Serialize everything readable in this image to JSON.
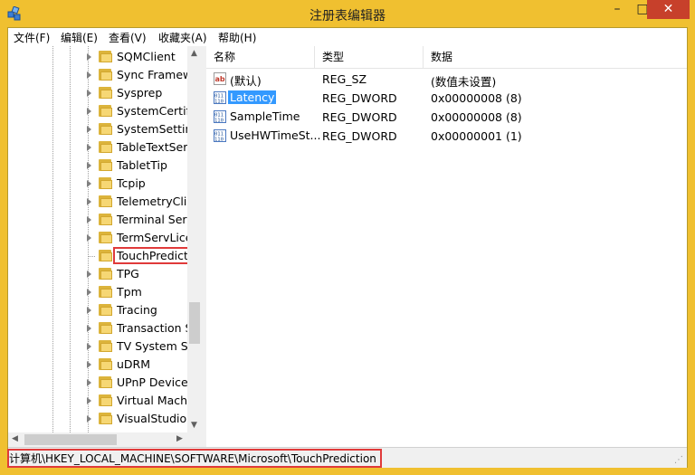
{
  "window": {
    "title": "注册表编辑器",
    "minimize_glyph": "–",
    "maximize_glyph": "□",
    "close_glyph": "✕"
  },
  "menu": [
    {
      "label": "文件(F)"
    },
    {
      "label": "编辑(E)"
    },
    {
      "label": "查看(V)"
    },
    {
      "label": "收藏夹(A)"
    },
    {
      "label": "帮助(H)"
    }
  ],
  "tree": {
    "items": [
      {
        "label": "SQMClient",
        "expandable": true
      },
      {
        "label": "Sync Framewo",
        "expandable": true
      },
      {
        "label": "Sysprep",
        "expandable": true
      },
      {
        "label": "SystemCertific",
        "expandable": true
      },
      {
        "label": "SystemSetting",
        "expandable": true
      },
      {
        "label": "TableTextServ",
        "expandable": true
      },
      {
        "label": "TabletTip",
        "expandable": true
      },
      {
        "label": "Tcpip",
        "expandable": true
      },
      {
        "label": "TelemetryClie",
        "expandable": true
      },
      {
        "label": "Terminal Serv",
        "expandable": true
      },
      {
        "label": "TermServLice",
        "expandable": true
      },
      {
        "label": "TouchPredict",
        "expandable": false,
        "selected": true
      },
      {
        "label": "TPG",
        "expandable": true
      },
      {
        "label": "Tpm",
        "expandable": true
      },
      {
        "label": "Tracing",
        "expandable": true
      },
      {
        "label": "Transaction S",
        "expandable": true
      },
      {
        "label": "TV System Se",
        "expandable": true
      },
      {
        "label": "uDRM",
        "expandable": true
      },
      {
        "label": "UPnP Device",
        "expandable": true
      },
      {
        "label": "Virtual Machi",
        "expandable": true
      },
      {
        "label": "VisualStudio",
        "expandable": true
      }
    ]
  },
  "list": {
    "columns": [
      "名称",
      "类型",
      "数据"
    ],
    "rows": [
      {
        "name": "(默认)",
        "type": "REG_SZ",
        "data": "(数值未设置)",
        "icon": "string-value-icon"
      },
      {
        "name": "Latency",
        "type": "REG_DWORD",
        "data": "0x00000008 (8)",
        "icon": "binary-value-icon",
        "selected": true
      },
      {
        "name": "SampleTime",
        "type": "REG_DWORD",
        "data": "0x00000008 (8)",
        "icon": "binary-value-icon"
      },
      {
        "name": "UseHWTimeSt...",
        "type": "REG_DWORD",
        "data": "0x00000001 (1)",
        "icon": "binary-value-icon"
      }
    ]
  },
  "status": {
    "path": "计算机\\HKEY_LOCAL_MACHINE\\SOFTWARE\\Microsoft\\TouchPrediction"
  },
  "colors": {
    "frame": "#f0c030",
    "close_button": "#c7402b",
    "highlight": "#e03a3a",
    "selection": "#3399ff"
  }
}
